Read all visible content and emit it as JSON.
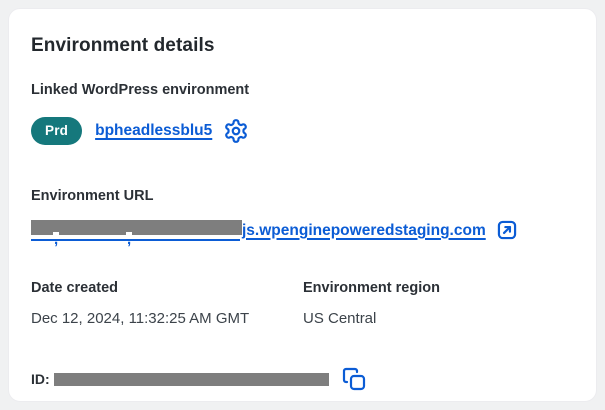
{
  "card": {
    "title": "Environment details",
    "linked_environment": {
      "label": "Linked WordPress environment",
      "badge_label": "Prd",
      "environment_link": "bpheadlessblu5"
    },
    "environment_url": {
      "label": "Environment URL",
      "visible_link_text": "js.wpenginepoweredstaging.com",
      "redacted_prefix": true
    },
    "date_created": {
      "label": "Date created",
      "value": "Dec 12, 2024, 11:32:25 AM GMT"
    },
    "environment_region": {
      "label": "Environment region",
      "value": "US Central"
    },
    "id_field": {
      "label": "ID:",
      "redacted_value": true
    }
  },
  "icons": {
    "settings": "gear-icon",
    "external_link": "external-link-icon",
    "copy": "copy-icon"
  },
  "colors": {
    "link_blue": "#0b5cd5",
    "badge_teal": "#15787c",
    "redaction_gray": "#7e7e7e",
    "heading_text": "#23282d",
    "value_text": "#3c434a",
    "card_background": "#ffffff",
    "page_background": "#f0f1f2"
  }
}
